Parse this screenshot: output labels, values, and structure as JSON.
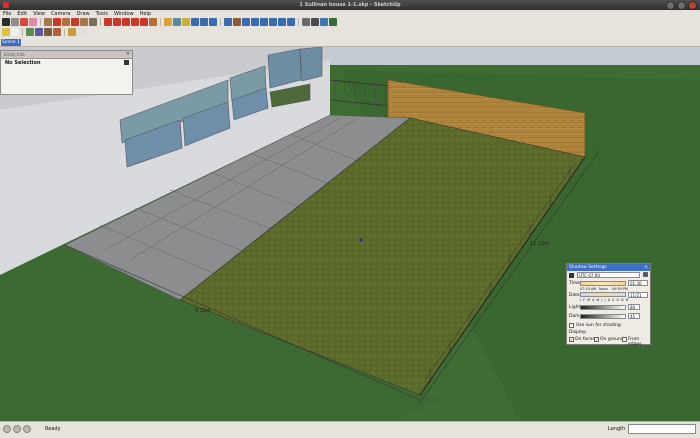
{
  "window": {
    "title": "1 Sullivan house 1-1.skp - SketchUp"
  },
  "menu": [
    "File",
    "Edit",
    "View",
    "Camera",
    "Draw",
    "Tools",
    "Window",
    "Help"
  ],
  "toolbar_row1": [
    {
      "icon": "select-arrow-icon",
      "color": "#2c2c2c"
    },
    {
      "icon": "make-component-icon",
      "color": "#8f8f8f"
    },
    {
      "icon": "paint-bucket-icon",
      "color": "#d24b3a"
    },
    {
      "icon": "eraser-icon",
      "color": "#e289a6"
    },
    {
      "icon": "rectangle-icon",
      "color": "#a47a4a"
    },
    {
      "icon": "line-pencil-icon",
      "color": "#c8392c"
    },
    {
      "icon": "circle-icon",
      "color": "#b46d3b"
    },
    {
      "icon": "arc-icon",
      "color": "#c8392c"
    },
    {
      "icon": "polygon-icon",
      "color": "#a47a4a"
    },
    {
      "icon": "freehand-icon",
      "color": "#7b6b5b"
    },
    {
      "icon": "move-icon",
      "color": "#c8392c"
    },
    {
      "icon": "push-pull-icon",
      "color": "#c8392c"
    },
    {
      "icon": "rotate-icon",
      "color": "#c8392c"
    },
    {
      "icon": "follow-me-icon",
      "color": "#c8392c"
    },
    {
      "icon": "scale-icon",
      "color": "#c8392c"
    },
    {
      "icon": "offset-icon",
      "color": "#b46d3b"
    },
    {
      "icon": "tape-measure-icon",
      "color": "#d9a23a"
    },
    {
      "icon": "dimension-icon",
      "color": "#5a8a9c"
    },
    {
      "icon": "protractor-icon",
      "color": "#c8b23a"
    },
    {
      "icon": "text-icon",
      "color": "#3a6ab0"
    },
    {
      "icon": "axes-icon",
      "color": "#3a6ab0"
    },
    {
      "icon": "3d-text-icon",
      "color": "#3a6ab0"
    },
    {
      "icon": "orbit-icon",
      "color": "#3a6ab0"
    },
    {
      "icon": "pan-icon",
      "color": "#8a5a3a"
    },
    {
      "icon": "zoom-icon",
      "color": "#3a6ab0"
    },
    {
      "icon": "zoom-window-icon",
      "color": "#3a6ab0"
    },
    {
      "icon": "zoom-extents-icon",
      "color": "#3a6ab0"
    },
    {
      "icon": "previous-view-icon",
      "color": "#3a6ab0"
    },
    {
      "icon": "position-camera-icon",
      "color": "#3a6ab0"
    },
    {
      "icon": "walk-icon",
      "color": "#3a6ab0"
    },
    {
      "icon": "look-around-icon",
      "color": "#6a6a6a"
    },
    {
      "icon": "section-plane-icon",
      "color": "#4a4a4a"
    },
    {
      "icon": "google-earth-icon",
      "color": "#3a7ab0"
    },
    {
      "icon": "warehouse-icon",
      "color": "#3a6a3a"
    }
  ],
  "toolbar_row2": [
    {
      "icon": "new-file-icon",
      "color": "#e0c24a"
    },
    {
      "icon": "open-file-icon",
      "color": "#f0f0f0"
    },
    {
      "icon": "get-models-icon",
      "color": "#5a8a5a"
    },
    {
      "icon": "share-model-icon",
      "color": "#5a5aa0"
    },
    {
      "icon": "share-component-icon",
      "color": "#7a5a3a"
    },
    {
      "icon": "add-location-icon",
      "color": "#b0603a"
    },
    {
      "icon": "component-icon",
      "color": "#c89a3a"
    },
    {
      "icon": "export-icon",
      "color": "#e0e0e0"
    }
  ],
  "scene": {
    "tab_label": "Scene 1"
  },
  "entity_info": {
    "header": "Entity Info",
    "selection": "No Selection"
  },
  "viewport": {
    "dim_front": "9.11m",
    "dim_side": "11.13m"
  },
  "shadow_settings": {
    "title": "Shadow Settings",
    "timezone": "UTC-07:00",
    "time_label": "Time",
    "time_scale_start": "07:19 AM",
    "time_scale_mid": "Noon",
    "time_scale_end": "04:59 PM",
    "time_value": "01:30",
    "date_label": "Date",
    "date_months": "J F M A M J J A S O N D",
    "date_value": "11/21",
    "light_label": "Light",
    "light_value": "80",
    "dark_label": "Dark",
    "dark_value": "45",
    "sun_shading_label": "Use sun for shading",
    "display_label": "Display:",
    "on_faces_label": "On faces",
    "on_ground_label": "On ground",
    "from_edges_label": "From edges",
    "use_sun": false,
    "on_faces": true,
    "on_ground": true,
    "from_edges": false
  },
  "status": {
    "text": "Ready",
    "length_label": "Length"
  }
}
